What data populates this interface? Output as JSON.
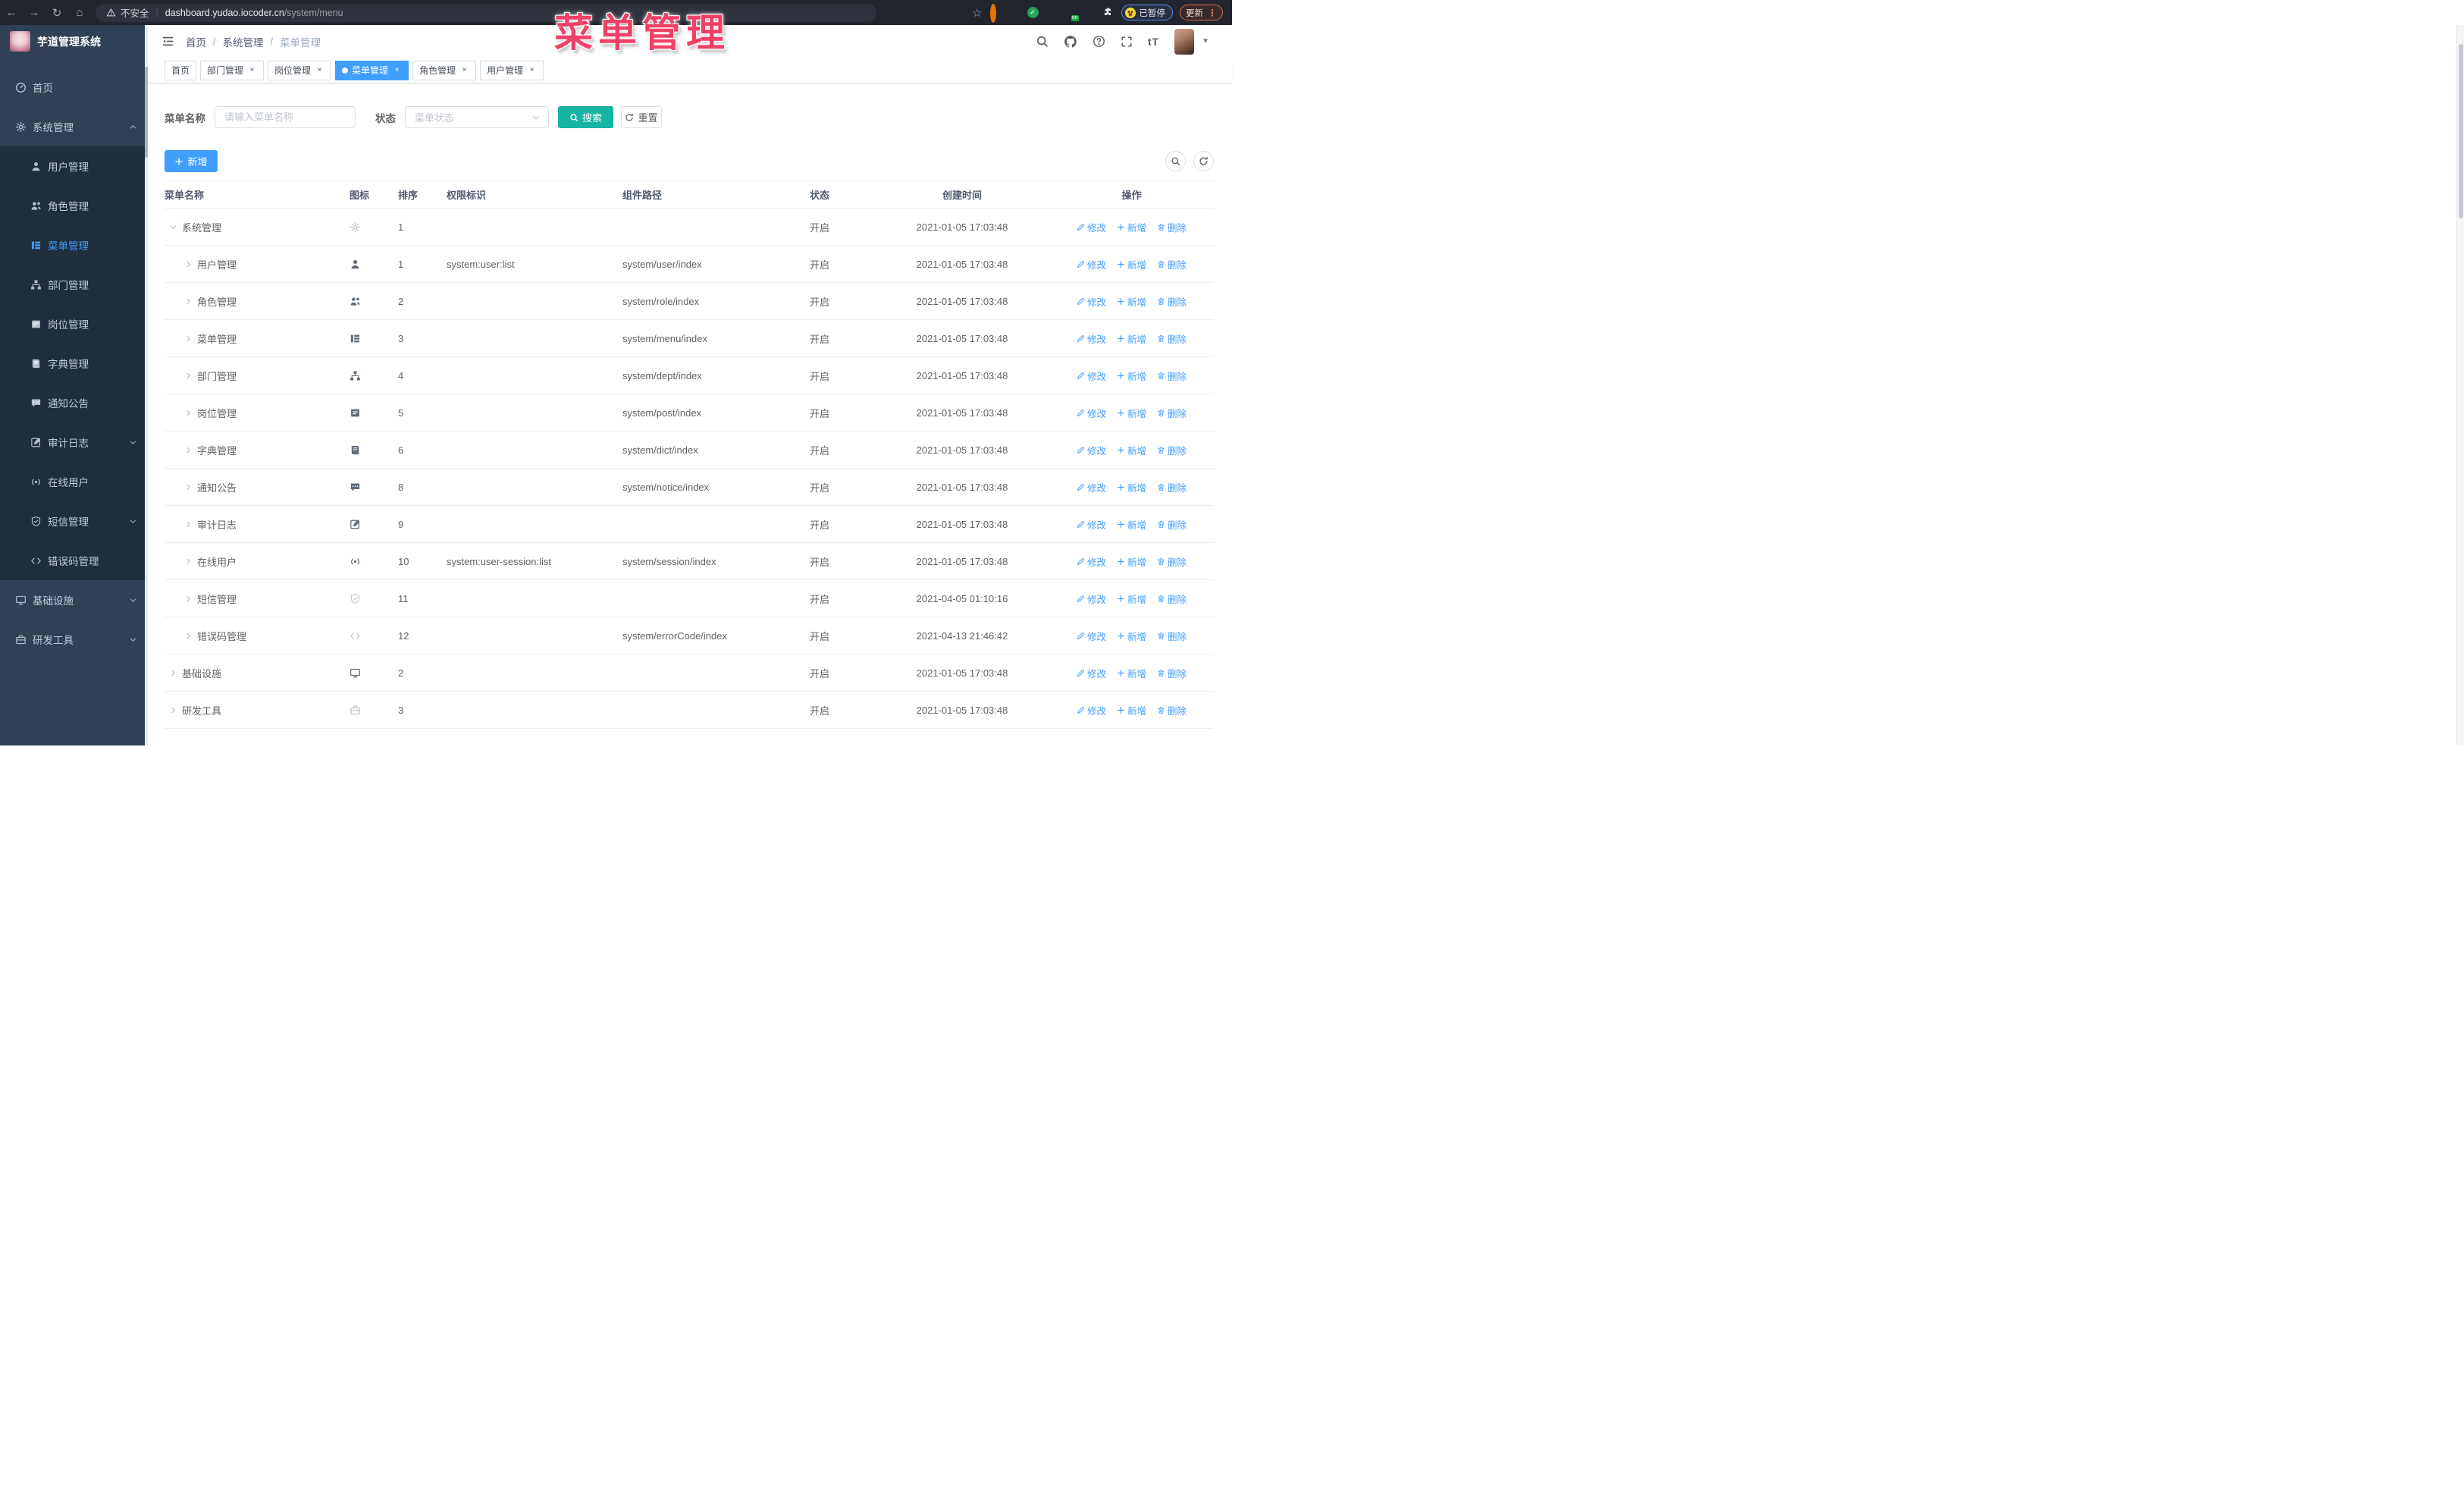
{
  "browser": {
    "security_label": "不安全",
    "url_domain": "dashboard.yudao.iocoder.cn",
    "url_path": "/system/menu",
    "paused_badge": "已暂停",
    "update_button": "更新"
  },
  "overlay": {
    "title": "菜单管理"
  },
  "sidebar": {
    "app_title": "芋道管理系统",
    "items": [
      {
        "key": "home",
        "label": "首页",
        "icon": "dashboard-icon",
        "level": "top"
      },
      {
        "key": "system",
        "label": "系统管理",
        "icon": "gear-icon",
        "level": "top",
        "chevron": "up",
        "expanded": true
      },
      {
        "key": "user",
        "label": "用户管理",
        "icon": "user-icon",
        "level": "sub"
      },
      {
        "key": "role",
        "label": "角色管理",
        "icon": "peoples-icon",
        "level": "sub"
      },
      {
        "key": "menu",
        "label": "菜单管理",
        "icon": "tree-table-icon",
        "level": "sub",
        "active": true
      },
      {
        "key": "dept",
        "label": "部门管理",
        "icon": "tree-icon",
        "level": "sub"
      },
      {
        "key": "post",
        "label": "岗位管理",
        "icon": "post-icon",
        "level": "sub"
      },
      {
        "key": "dict",
        "label": "字典管理",
        "icon": "dict-icon",
        "level": "sub"
      },
      {
        "key": "notice",
        "label": "通知公告",
        "icon": "message-icon",
        "level": "sub"
      },
      {
        "key": "audit-log",
        "label": "审计日志",
        "icon": "log-icon",
        "level": "sub",
        "chevron": "down"
      },
      {
        "key": "online-user",
        "label": "在线用户",
        "icon": "online-icon",
        "level": "sub"
      },
      {
        "key": "sms",
        "label": "短信管理",
        "icon": "shield-icon",
        "level": "sub",
        "chevron": "down"
      },
      {
        "key": "error-code",
        "label": "错误码管理",
        "icon": "code-icon",
        "level": "sub"
      },
      {
        "key": "infra",
        "label": "基础设施",
        "icon": "monitor-icon",
        "level": "top",
        "chevron": "down"
      },
      {
        "key": "dev-tools",
        "label": "研发工具",
        "icon": "toolbox-icon",
        "level": "top",
        "chevron": "down"
      }
    ]
  },
  "header": {
    "breadcrumb": [
      "首页",
      "系统管理",
      "菜单管理"
    ]
  },
  "tabs": [
    {
      "key": "home",
      "label": "首页",
      "closable": false,
      "active": false
    },
    {
      "key": "dept",
      "label": "部门管理",
      "closable": true,
      "active": false
    },
    {
      "key": "post",
      "label": "岗位管理",
      "closable": true,
      "active": false
    },
    {
      "key": "menu",
      "label": "菜单管理",
      "closable": true,
      "active": true
    },
    {
      "key": "role",
      "label": "角色管理",
      "closable": true,
      "active": false
    },
    {
      "key": "user",
      "label": "用户管理",
      "closable": true,
      "active": false
    }
  ],
  "filters": {
    "name_label": "菜单名称",
    "name_placeholder": "请输入菜单名称",
    "name_value": "",
    "status_label": "状态",
    "status_placeholder": "菜单状态",
    "search_label": "搜索",
    "reset_label": "重置"
  },
  "toolbar": {
    "add_label": "新增"
  },
  "table": {
    "columns": [
      "菜单名称",
      "图标",
      "排序",
      "权限标识",
      "组件路径",
      "状态",
      "创建时间",
      "操作"
    ],
    "action_labels": {
      "edit": "修改",
      "add": "新增",
      "delete": "删除"
    },
    "rows": [
      {
        "key": "system",
        "name": "系统管理",
        "level": 0,
        "expand": "down",
        "icon": "gear-icon",
        "muted": true,
        "sort": "1",
        "perm": "",
        "path": "",
        "status": "开启",
        "time": "2021-01-05 17:03:48"
      },
      {
        "key": "user",
        "name": "用户管理",
        "level": 1,
        "expand": "right",
        "icon": "user-icon",
        "muted": false,
        "sort": "1",
        "perm": "system:user:list",
        "path": "system/user/index",
        "status": "开启",
        "time": "2021-01-05 17:03:48"
      },
      {
        "key": "role",
        "name": "角色管理",
        "level": 1,
        "expand": "right",
        "icon": "peoples-icon",
        "muted": false,
        "sort": "2",
        "perm": "",
        "path": "system/role/index",
        "status": "开启",
        "time": "2021-01-05 17:03:48"
      },
      {
        "key": "menu",
        "name": "菜单管理",
        "level": 1,
        "expand": "right",
        "icon": "tree-table-icon",
        "muted": false,
        "sort": "3",
        "perm": "",
        "path": "system/menu/index",
        "status": "开启",
        "time": "2021-01-05 17:03:48"
      },
      {
        "key": "dept",
        "name": "部门管理",
        "level": 1,
        "expand": "right",
        "icon": "tree-icon",
        "muted": false,
        "sort": "4",
        "perm": "",
        "path": "system/dept/index",
        "status": "开启",
        "time": "2021-01-05 17:03:48"
      },
      {
        "key": "post",
        "name": "岗位管理",
        "level": 1,
        "expand": "right",
        "icon": "post-icon",
        "muted": false,
        "sort": "5",
        "perm": "",
        "path": "system/post/index",
        "status": "开启",
        "time": "2021-01-05 17:03:48"
      },
      {
        "key": "dict",
        "name": "字典管理",
        "level": 1,
        "expand": "right",
        "icon": "dict-icon",
        "muted": false,
        "sort": "6",
        "perm": "",
        "path": "system/dict/index",
        "status": "开启",
        "time": "2021-01-05 17:03:48"
      },
      {
        "key": "notice",
        "name": "通知公告",
        "level": 1,
        "expand": "right",
        "icon": "message-icon",
        "muted": false,
        "sort": "8",
        "perm": "",
        "path": "system/notice/index",
        "status": "开启",
        "time": "2021-01-05 17:03:48"
      },
      {
        "key": "audit-log",
        "name": "审计日志",
        "level": 1,
        "expand": "right",
        "icon": "log-icon",
        "muted": false,
        "sort": "9",
        "perm": "",
        "path": "",
        "status": "开启",
        "time": "2021-01-05 17:03:48"
      },
      {
        "key": "online-user",
        "name": "在线用户",
        "level": 1,
        "expand": "right",
        "icon": "online-icon",
        "muted": false,
        "sort": "10",
        "perm": "system:user-session:list",
        "path": "system/session/index",
        "status": "开启",
        "time": "2021-01-05 17:03:48"
      },
      {
        "key": "sms",
        "name": "短信管理",
        "level": 1,
        "expand": "right",
        "icon": "shield-icon",
        "muted": true,
        "sort": "11",
        "perm": "",
        "path": "",
        "status": "开启",
        "time": "2021-04-05 01:10:16"
      },
      {
        "key": "error-code",
        "name": "错误码管理",
        "level": 1,
        "expand": "right",
        "icon": "code-icon",
        "muted": true,
        "sort": "12",
        "perm": "",
        "path": "system/errorCode/index",
        "status": "开启",
        "time": "2021-04-13 21:46:42"
      },
      {
        "key": "infra",
        "name": "基础设施",
        "level": 0,
        "expand": "right",
        "icon": "monitor-icon",
        "muted": false,
        "sort": "2",
        "perm": "",
        "path": "",
        "status": "开启",
        "time": "2021-01-05 17:03:48"
      },
      {
        "key": "dev-tools",
        "name": "研发工具",
        "level": 0,
        "expand": "right",
        "icon": "toolbox-icon",
        "muted": true,
        "sort": "3",
        "perm": "",
        "path": "",
        "status": "开启",
        "time": "2021-01-05 17:03:48"
      }
    ]
  },
  "colors": {
    "primary": "#409eff",
    "search_button": "#17b3a3",
    "overlay_text": "#ef4166",
    "sidebar_bg": "#304156",
    "sidebar_submenu_bg": "#1f2d3d",
    "active_tab_bg": "#409eff"
  }
}
